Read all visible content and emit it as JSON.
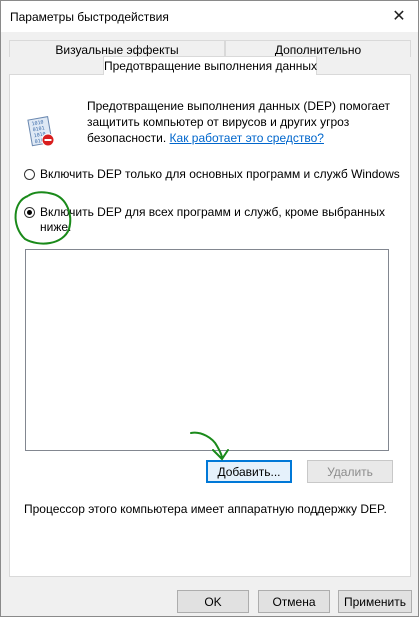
{
  "window": {
    "title": "Параметры быстродействия"
  },
  "tabs": [
    {
      "label": "Визуальные эффекты"
    },
    {
      "label": "Дополнительно"
    },
    {
      "label": "Предотвращение выполнения данных"
    }
  ],
  "dep": {
    "description": "Предотвращение выполнения данных (DEP) помогает защитить компьютер от вирусов и других угроз безопасности.",
    "link": "Как работает это средство?",
    "options": [
      {
        "label": "Включить DEP только для основных программ и служб Windows",
        "checked": false
      },
      {
        "label": "Включить DEP для всех программ и служб, кроме выбранных ниже:",
        "checked": true
      }
    ],
    "add_label": "Добавить...",
    "remove_label": "Удалить",
    "hardware_note": "Процессор этого компьютера имеет аппаратную поддержку DEP."
  },
  "footer": {
    "ok_label": "OK",
    "cancel_label": "Отмена",
    "apply_label": "Применить"
  },
  "colors": {
    "link": "#0066cc",
    "annotation": "#1a8a1a",
    "focus": "#0078d7"
  }
}
